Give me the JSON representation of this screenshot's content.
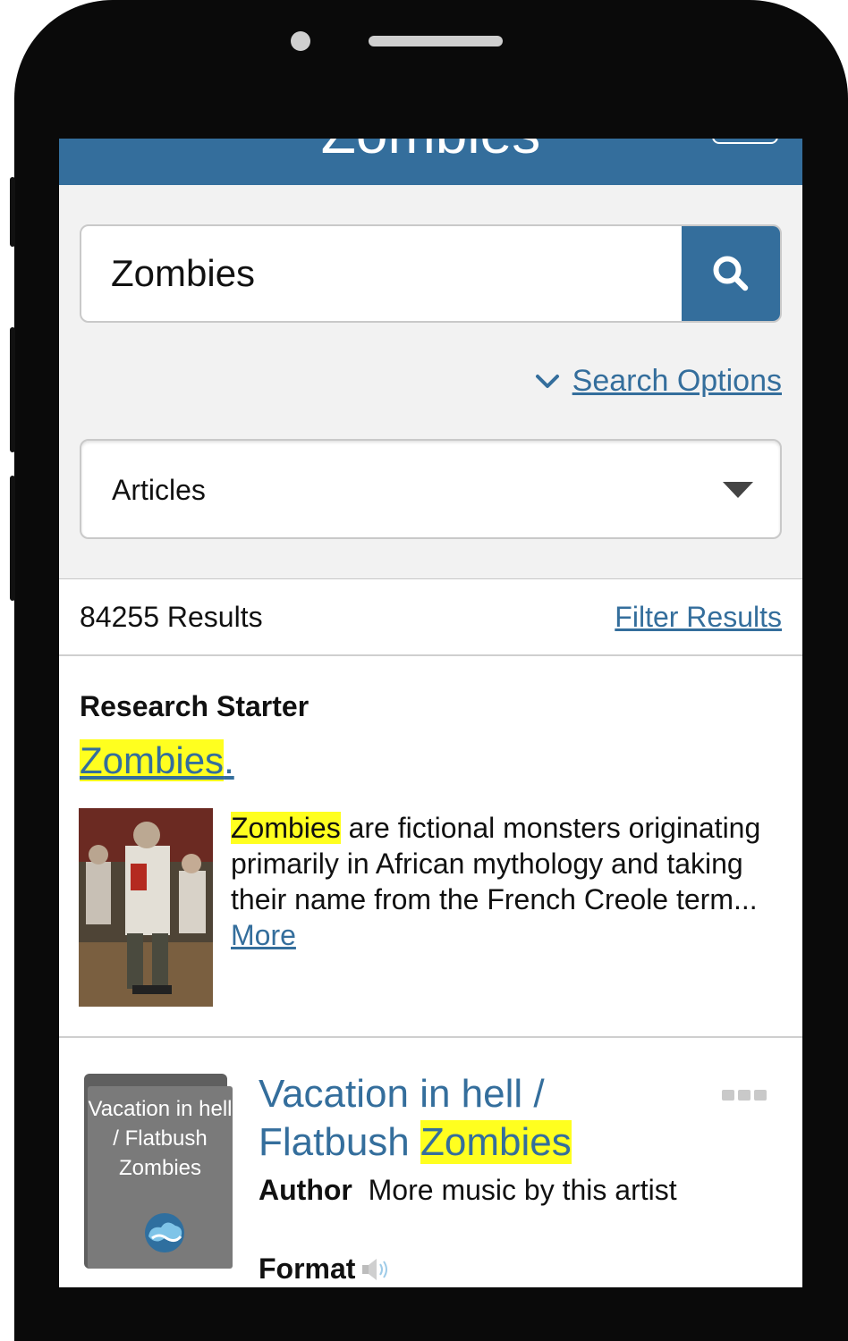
{
  "header": {
    "title": "Zombies"
  },
  "search": {
    "query": "Zombies",
    "options_label": "Search Options",
    "source_type": "Articles"
  },
  "results": {
    "count_label": "84255 Results",
    "filter_label": "Filter Results"
  },
  "research_starter": {
    "label": "Research Starter",
    "title_highlight": "Zombies",
    "title_rest": ".",
    "snippet_highlight": "Zombies",
    "snippet_rest": " are fictional monsters originating primarily in African mythology and taking their name from the French Creole term... ",
    "more_label": "More"
  },
  "result_item": {
    "cover_title": "Vacation in hell / Flatbush Zombies",
    "title_plain": "Vacation in hell / Flatbush ",
    "title_highlight": "Zombies",
    "author_label": "Author",
    "author_value": "More music by this artist",
    "format_label": "Format"
  },
  "colors": {
    "brand": "#346e9c",
    "highlight": "#ffff1f",
    "panel": "#f2f2f2"
  },
  "icons": [
    "search-icon",
    "chevron-down-icon",
    "dropdown-arrow-icon",
    "more-options-icon",
    "cloud-library-icon",
    "speaker-icon"
  ]
}
